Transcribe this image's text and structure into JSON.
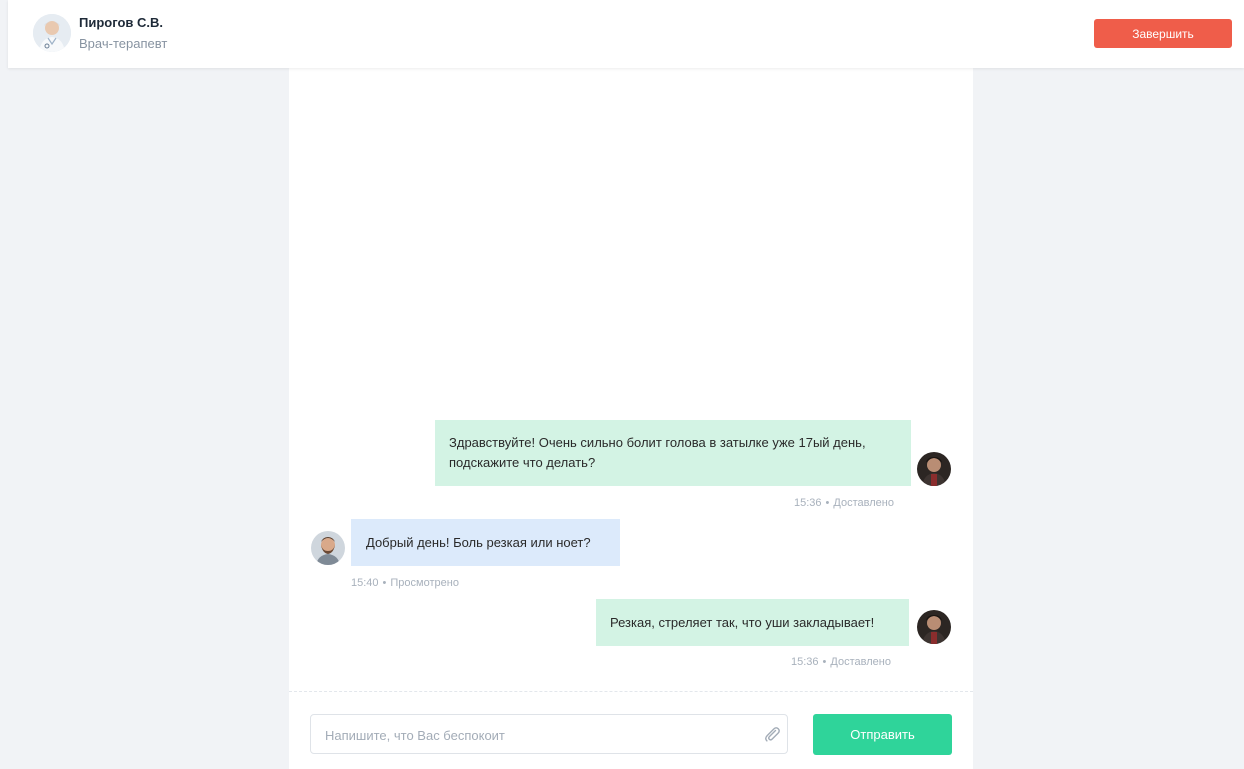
{
  "header": {
    "doctor_name": "Пирогов С.В.",
    "doctor_role": "Врач-терапевт",
    "finish_label": "Завершить"
  },
  "messages": [
    {
      "sender": "patient",
      "text_line1": "Здравствуйте! Очень сильно болит голова в затылке уже 17ый день,",
      "text_line2": "подскажите что делать?",
      "time": "15:36",
      "status": "Доставлено"
    },
    {
      "sender": "doctor",
      "text": "Добрый день! Боль резкая или ноет?",
      "time": "15:40",
      "status": "Просмотрено"
    },
    {
      "sender": "patient",
      "text": "Резкая, стреляет так, что уши закладывает!",
      "time": "15:36",
      "status": "Доставлено"
    }
  ],
  "composer": {
    "placeholder": "Напишите, что Вас беспокоит",
    "send_label": "Отправить"
  },
  "colors": {
    "finish": "#ef5d4a",
    "send": "#2fd49a",
    "outgoing_bubble": "#d3f3e4",
    "incoming_bubble": "#dceafb"
  }
}
